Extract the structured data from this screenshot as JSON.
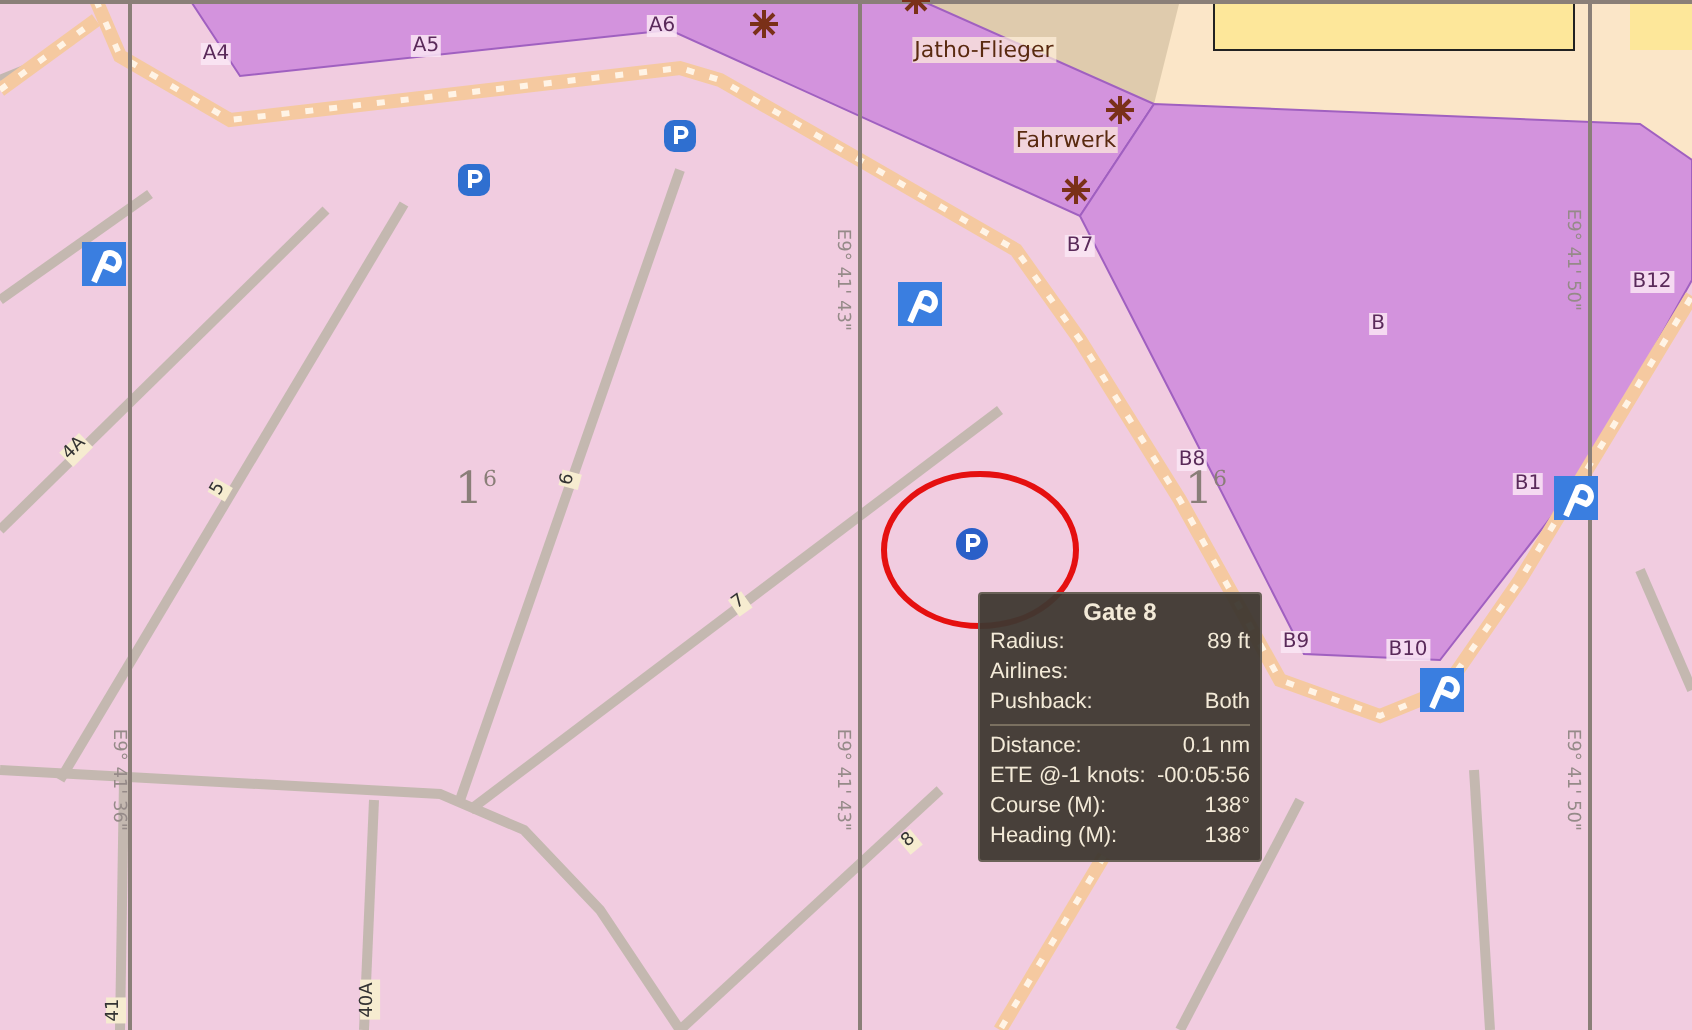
{
  "map": {
    "gate_labels": [
      "A4",
      "A5",
      "A6",
      "B7",
      "B8",
      "B9",
      "B10",
      "B1",
      "B12",
      "B"
    ],
    "place_labels": [
      "Jatho-Flieger",
      "Fahrwerk"
    ],
    "stand_labels": [
      "4A",
      "5",
      "6",
      "7",
      "8",
      "40A",
      "41"
    ],
    "grid_labels": [
      "E9° 41' 43\"",
      "E9° 41' 50\"",
      "E9° 41' 36\"",
      "E9° 41' 43\"",
      "E9° 41' 50\""
    ],
    "level_labels": [
      "1$^{6}$",
      "1$^{6}$"
    ]
  },
  "tooltip": {
    "title": "Gate 8",
    "sections": [
      [
        {
          "label": "Radius:",
          "value": "89 ft"
        },
        {
          "label": "Airlines:"
        },
        {
          "label": "Pushback:",
          "value": "Both"
        }
      ],
      [
        {
          "label": "Distance:",
          "value": "0.1 nm"
        },
        {
          "label": "ETE @-1 knots:",
          "value": "-00:05:56"
        },
        {
          "label": "Course (M):",
          "value": "138°"
        },
        {
          "label": "Heading (M):",
          "value": "138°"
        }
      ]
    ]
  }
}
